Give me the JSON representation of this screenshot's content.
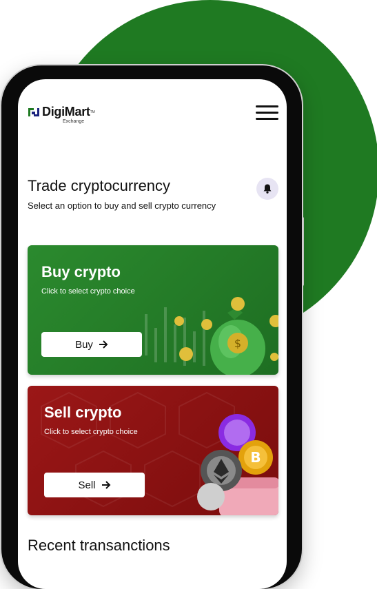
{
  "header": {
    "logo_name": "DigiMart",
    "logo_sub": "Exchange",
    "logo_tm": "TM"
  },
  "intro": {
    "title": "Trade cryptocurrency",
    "subtitle": "Select an option to buy and sell crypto currency"
  },
  "buy_card": {
    "title": "Buy crypto",
    "subtitle": "Click to select  crypto choice",
    "button_label": "Buy"
  },
  "sell_card": {
    "title": "Sell crypto",
    "subtitle": "Click to select  crypto choice",
    "button_label": "Sell"
  },
  "recent": {
    "title": "Recent transanctions"
  },
  "colors": {
    "brand_green": "#1f7a22",
    "buy_green": "#2b8a2e",
    "sell_red": "#9b1717",
    "bell_bg": "#e7e4f3"
  },
  "icons": [
    "menu-icon",
    "bell-icon",
    "arrow-right-icon",
    "money-bag-icon",
    "crypto-coins-icon",
    "wallet-icon"
  ]
}
